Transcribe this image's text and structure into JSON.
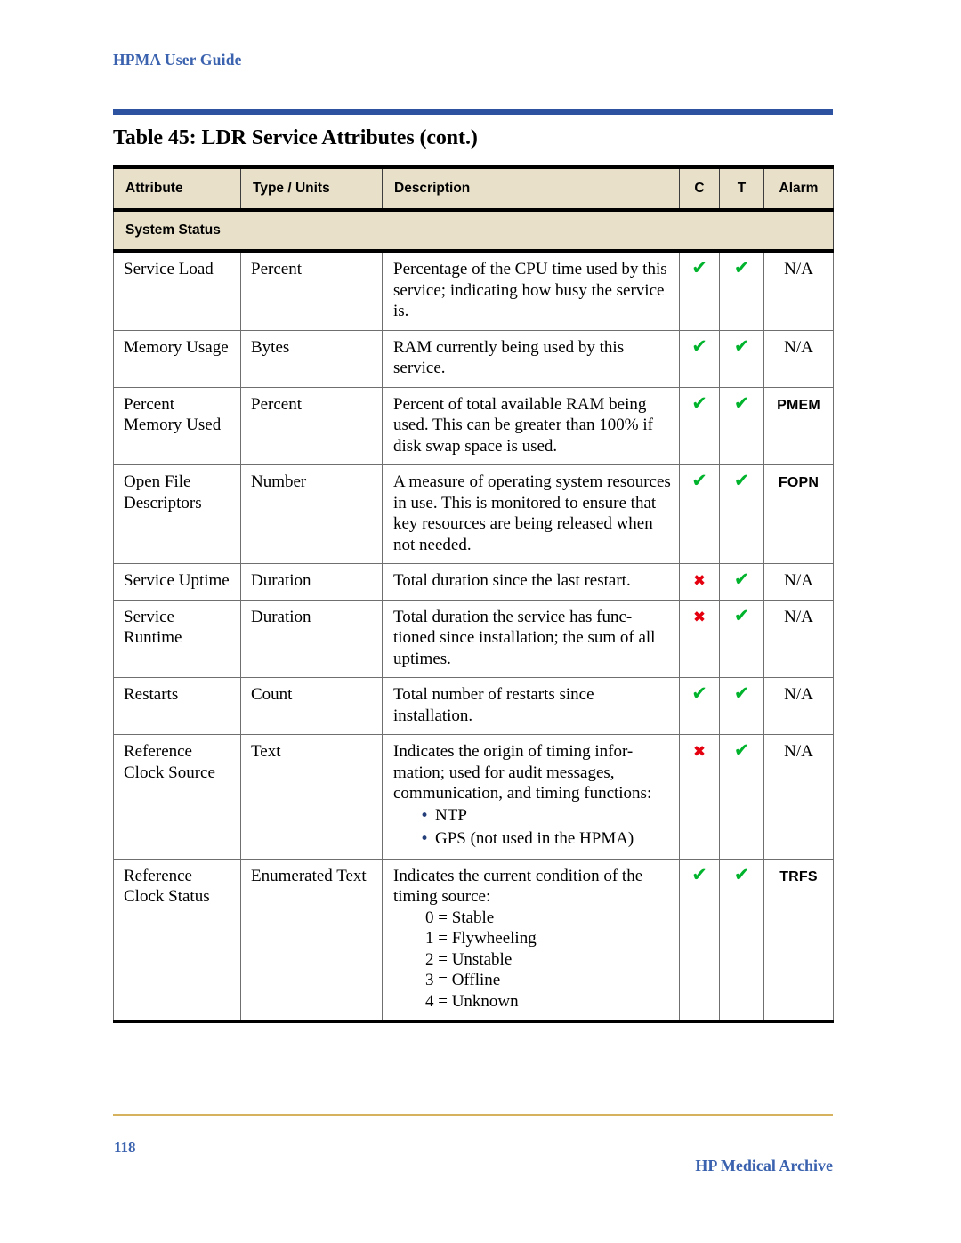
{
  "page": {
    "running_head": "HPMA User Guide",
    "caption": "Table 45: LDR Service Attributes (cont.)",
    "page_number": "118",
    "footer_right": "HP Medical Archive"
  },
  "colors": {
    "head_rule": "#2c52a0",
    "head_text": "#3a62ae",
    "table_header_fill": "#e8e0c8",
    "check": "#00b32c",
    "cross": "#e4000f",
    "bullet": "#243f7a",
    "foot_rule": "#d6b25f"
  },
  "table": {
    "headers": {
      "attribute": "Attribute",
      "type_units": "Type / Units",
      "description": "Description",
      "c": "C",
      "t": "T",
      "alarm": "Alarm"
    },
    "section_band": "System Status",
    "rows": [
      {
        "attribute": "Service Load",
        "type": "Percent",
        "description": "Percentage of the CPU time used by this service; indicating how busy the service is.",
        "c": "check",
        "t": "check",
        "alarm": "N/A",
        "alarm_is_code": false
      },
      {
        "attribute": "Memory Usage",
        "type": "Bytes",
        "description": "RAM currently being used by this service.",
        "c": "check",
        "t": "check",
        "alarm": "N/A",
        "alarm_is_code": false
      },
      {
        "attribute": "Percent Memory Used",
        "type": "Percent",
        "description": "Percent of total available RAM being used. This can be greater than 100% if disk swap space is used.",
        "c": "check",
        "t": "check",
        "alarm": "PMEM",
        "alarm_is_code": true
      },
      {
        "attribute": "Open File Descriptors",
        "type": "Number",
        "description": "A measure of operating system resources in use. This is monitored to ensure that key resources are being released when not needed.",
        "c": "check",
        "t": "check",
        "alarm": "FOPN",
        "alarm_is_code": true
      },
      {
        "attribute": "Service Uptime",
        "type": "Duration",
        "description": "Total duration since the last restart.",
        "c": "cross",
        "t": "check",
        "alarm": "N/A",
        "alarm_is_code": false
      },
      {
        "attribute": "Service Runtime",
        "type": "Duration",
        "description": "Total duration the service has func-tioned since installation; the sum of all uptimes.",
        "c": "cross",
        "t": "check",
        "alarm": "N/A",
        "alarm_is_code": false
      },
      {
        "attribute": "Restarts",
        "type": "Count",
        "description": "Total number of restarts since installation.",
        "c": "check",
        "t": "check",
        "alarm": "N/A",
        "alarm_is_code": false
      },
      {
        "attribute": "Reference Clock Source",
        "type": "Text",
        "description": "Indicates the origin of timing infor-mation; used for audit messages, communication, and timing functions:",
        "bullets": [
          "NTP",
          "GPS (not used in the HPMA)"
        ],
        "c": "cross",
        "t": "check",
        "alarm": "N/A",
        "alarm_is_code": false
      },
      {
        "attribute": "Reference Clock Status",
        "type": "Enumerated Text",
        "description": "Indicates the current condition of the timing source:",
        "enums": [
          "0 = Stable",
          "1 = Flywheeling",
          "2 = Unstable",
          "3 = Offline",
          "4 = Unknown"
        ],
        "c": "check",
        "t": "check",
        "alarm": "TRFS",
        "alarm_is_code": true
      }
    ]
  },
  "glyphs": {
    "check": "✔",
    "cross": "✖"
  }
}
